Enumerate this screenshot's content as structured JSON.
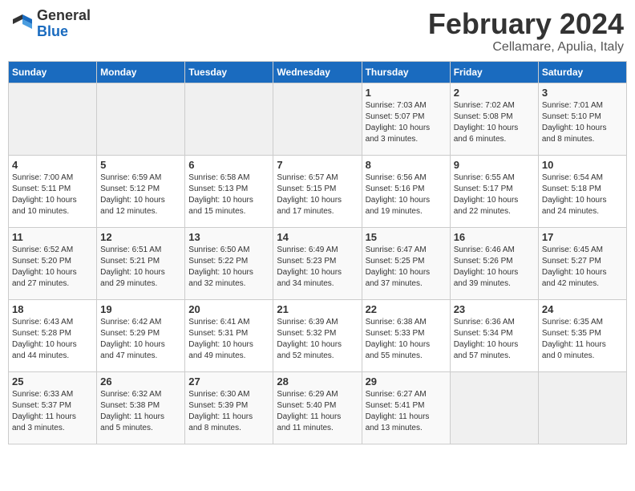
{
  "header": {
    "logo_general": "General",
    "logo_blue": "Blue",
    "title": "February 2024",
    "location": "Cellamare, Apulia, Italy"
  },
  "weekdays": [
    "Sunday",
    "Monday",
    "Tuesday",
    "Wednesday",
    "Thursday",
    "Friday",
    "Saturday"
  ],
  "weeks": [
    [
      {
        "day": "",
        "info": ""
      },
      {
        "day": "",
        "info": ""
      },
      {
        "day": "",
        "info": ""
      },
      {
        "day": "",
        "info": ""
      },
      {
        "day": "1",
        "info": "Sunrise: 7:03 AM\nSunset: 5:07 PM\nDaylight: 10 hours\nand 3 minutes."
      },
      {
        "day": "2",
        "info": "Sunrise: 7:02 AM\nSunset: 5:08 PM\nDaylight: 10 hours\nand 6 minutes."
      },
      {
        "day": "3",
        "info": "Sunrise: 7:01 AM\nSunset: 5:10 PM\nDaylight: 10 hours\nand 8 minutes."
      }
    ],
    [
      {
        "day": "4",
        "info": "Sunrise: 7:00 AM\nSunset: 5:11 PM\nDaylight: 10 hours\nand 10 minutes."
      },
      {
        "day": "5",
        "info": "Sunrise: 6:59 AM\nSunset: 5:12 PM\nDaylight: 10 hours\nand 12 minutes."
      },
      {
        "day": "6",
        "info": "Sunrise: 6:58 AM\nSunset: 5:13 PM\nDaylight: 10 hours\nand 15 minutes."
      },
      {
        "day": "7",
        "info": "Sunrise: 6:57 AM\nSunset: 5:15 PM\nDaylight: 10 hours\nand 17 minutes."
      },
      {
        "day": "8",
        "info": "Sunrise: 6:56 AM\nSunset: 5:16 PM\nDaylight: 10 hours\nand 19 minutes."
      },
      {
        "day": "9",
        "info": "Sunrise: 6:55 AM\nSunset: 5:17 PM\nDaylight: 10 hours\nand 22 minutes."
      },
      {
        "day": "10",
        "info": "Sunrise: 6:54 AM\nSunset: 5:18 PM\nDaylight: 10 hours\nand 24 minutes."
      }
    ],
    [
      {
        "day": "11",
        "info": "Sunrise: 6:52 AM\nSunset: 5:20 PM\nDaylight: 10 hours\nand 27 minutes."
      },
      {
        "day": "12",
        "info": "Sunrise: 6:51 AM\nSunset: 5:21 PM\nDaylight: 10 hours\nand 29 minutes."
      },
      {
        "day": "13",
        "info": "Sunrise: 6:50 AM\nSunset: 5:22 PM\nDaylight: 10 hours\nand 32 minutes."
      },
      {
        "day": "14",
        "info": "Sunrise: 6:49 AM\nSunset: 5:23 PM\nDaylight: 10 hours\nand 34 minutes."
      },
      {
        "day": "15",
        "info": "Sunrise: 6:47 AM\nSunset: 5:25 PM\nDaylight: 10 hours\nand 37 minutes."
      },
      {
        "day": "16",
        "info": "Sunrise: 6:46 AM\nSunset: 5:26 PM\nDaylight: 10 hours\nand 39 minutes."
      },
      {
        "day": "17",
        "info": "Sunrise: 6:45 AM\nSunset: 5:27 PM\nDaylight: 10 hours\nand 42 minutes."
      }
    ],
    [
      {
        "day": "18",
        "info": "Sunrise: 6:43 AM\nSunset: 5:28 PM\nDaylight: 10 hours\nand 44 minutes."
      },
      {
        "day": "19",
        "info": "Sunrise: 6:42 AM\nSunset: 5:29 PM\nDaylight: 10 hours\nand 47 minutes."
      },
      {
        "day": "20",
        "info": "Sunrise: 6:41 AM\nSunset: 5:31 PM\nDaylight: 10 hours\nand 49 minutes."
      },
      {
        "day": "21",
        "info": "Sunrise: 6:39 AM\nSunset: 5:32 PM\nDaylight: 10 hours\nand 52 minutes."
      },
      {
        "day": "22",
        "info": "Sunrise: 6:38 AM\nSunset: 5:33 PM\nDaylight: 10 hours\nand 55 minutes."
      },
      {
        "day": "23",
        "info": "Sunrise: 6:36 AM\nSunset: 5:34 PM\nDaylight: 10 hours\nand 57 minutes."
      },
      {
        "day": "24",
        "info": "Sunrise: 6:35 AM\nSunset: 5:35 PM\nDaylight: 11 hours\nand 0 minutes."
      }
    ],
    [
      {
        "day": "25",
        "info": "Sunrise: 6:33 AM\nSunset: 5:37 PM\nDaylight: 11 hours\nand 3 minutes."
      },
      {
        "day": "26",
        "info": "Sunrise: 6:32 AM\nSunset: 5:38 PM\nDaylight: 11 hours\nand 5 minutes."
      },
      {
        "day": "27",
        "info": "Sunrise: 6:30 AM\nSunset: 5:39 PM\nDaylight: 11 hours\nand 8 minutes."
      },
      {
        "day": "28",
        "info": "Sunrise: 6:29 AM\nSunset: 5:40 PM\nDaylight: 11 hours\nand 11 minutes."
      },
      {
        "day": "29",
        "info": "Sunrise: 6:27 AM\nSunset: 5:41 PM\nDaylight: 11 hours\nand 13 minutes."
      },
      {
        "day": "",
        "info": ""
      },
      {
        "day": "",
        "info": ""
      }
    ]
  ]
}
